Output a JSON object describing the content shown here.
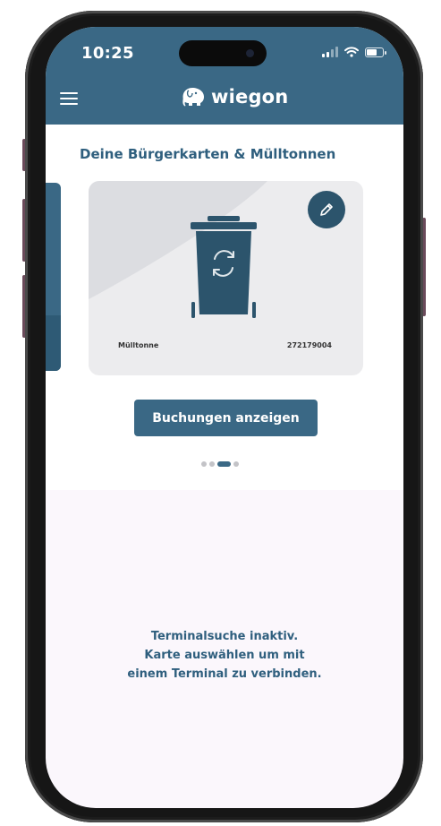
{
  "status_bar": {
    "time": "10:25"
  },
  "header": {
    "brand_name": "wiegon",
    "menu_icon": "hamburger-icon",
    "logo_icon": "elephant-logo-icon"
  },
  "section": {
    "title": "Deine Bürgerkarten & Mülltonnen"
  },
  "card": {
    "type_label": "Mülltonne",
    "number": "272179004",
    "icon": "waste-bin-icon",
    "edit_icon": "pencil-icon"
  },
  "actions": {
    "show_bookings_label": "Buchungen anzeigen"
  },
  "pagination": {
    "total": 4,
    "active_index": 2
  },
  "terminal": {
    "lines": [
      "Terminalsuche inaktiv.",
      "Karte auswählen um mit",
      "einem Terminal zu verbinden."
    ]
  },
  "colors": {
    "primary": "#3a6885",
    "primary_dark": "#2c546c",
    "card_bg": "#ececee",
    "page_bg": "#fbf7fc",
    "text_accent": "#2f5f7e"
  }
}
